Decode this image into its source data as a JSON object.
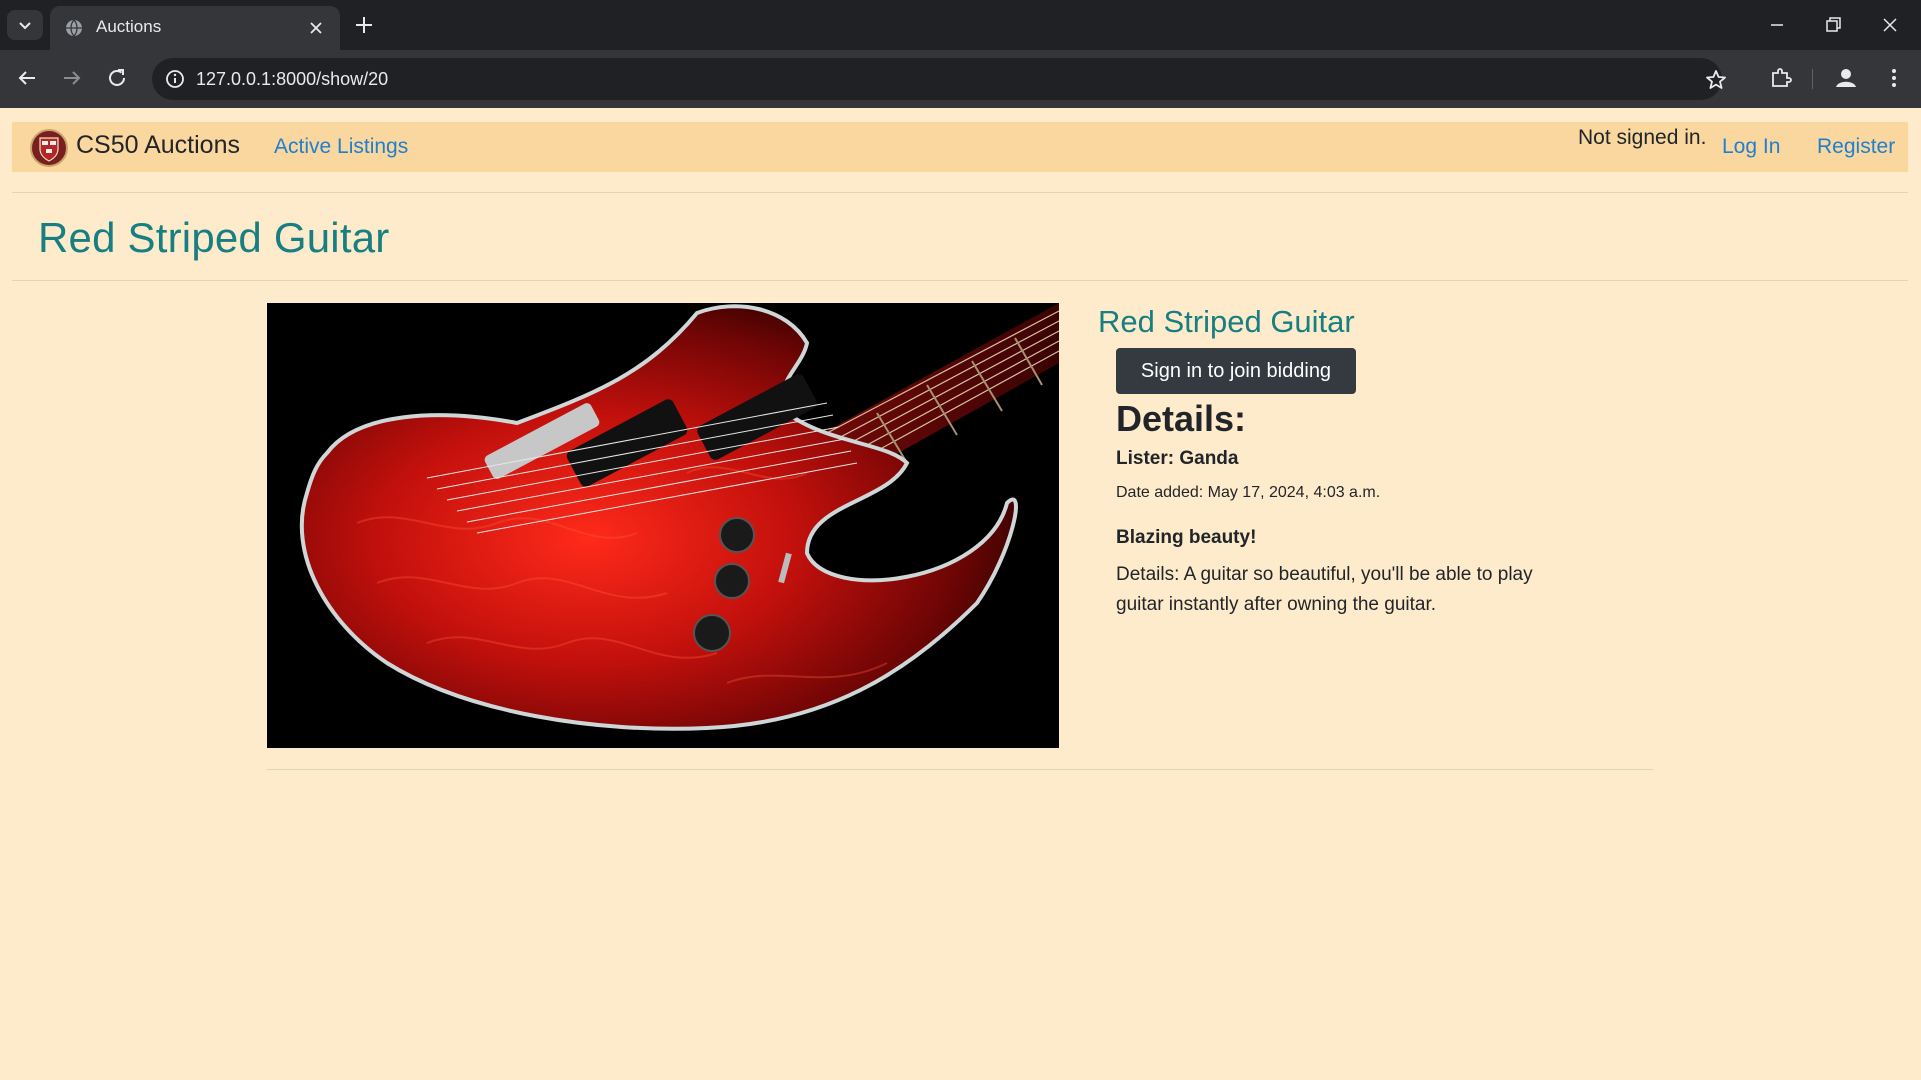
{
  "browser": {
    "tab_title": "Auctions",
    "url": "127.0.0.1:8000/show/20"
  },
  "navbar": {
    "brand": "CS50 Auctions",
    "active_listings": "Active Listings",
    "status": "Not signed in.",
    "login": "Log In",
    "register": "Register"
  },
  "listing": {
    "page_title": "Red Striped Guitar",
    "title": "Red Striped Guitar",
    "bid_button": "Sign in to join bidding",
    "details_heading": "Details:",
    "lister": "Lister: Ganda",
    "date_added": "Date added: May 17, 2024, 4:03 a.m.",
    "tagline": "Blazing beauty!",
    "description": "Details: A guitar so beautiful, you'll be able to play guitar instantly after owning the guitar."
  },
  "colors": {
    "page_background": "#feebcb",
    "navbar_background": "#f9d79e",
    "heading_teal": "#177e82",
    "link_blue": "#1f7fd0",
    "button_dark": "#343a40"
  }
}
